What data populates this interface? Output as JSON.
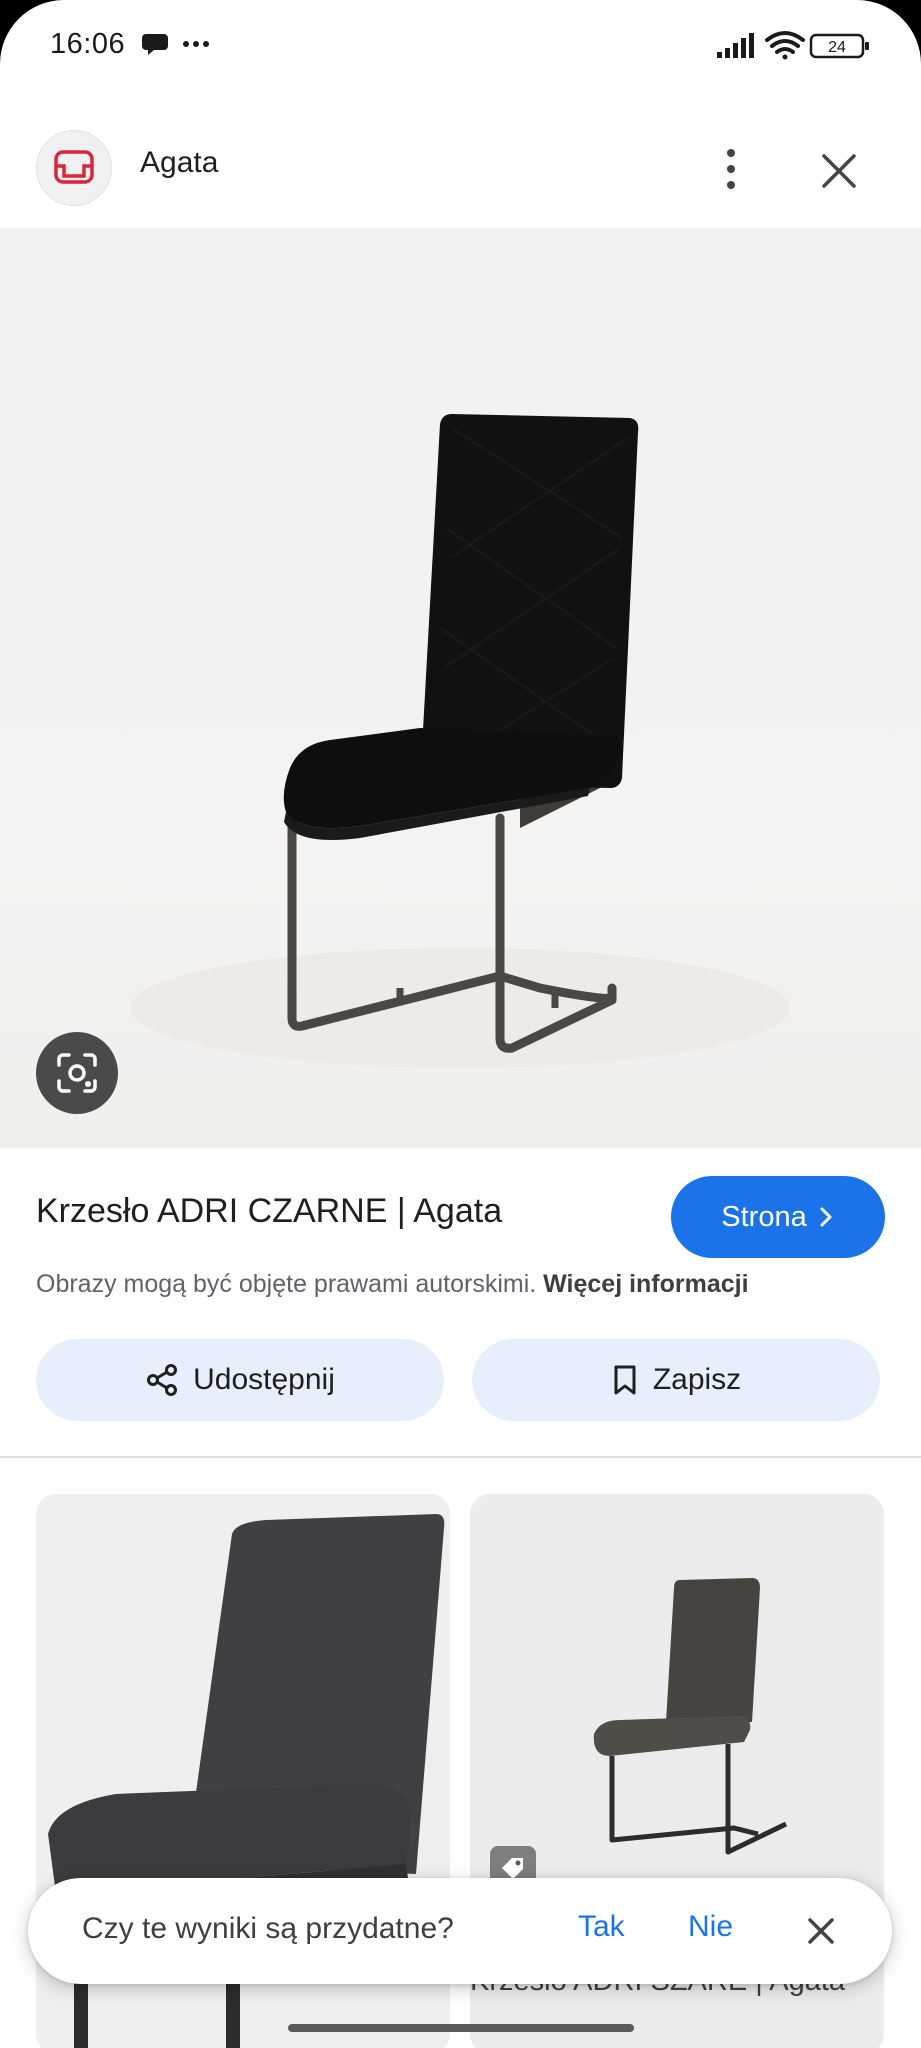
{
  "status_bar": {
    "time": "16:06",
    "battery": "24",
    "icons": [
      "chat-bubble-icon",
      "more-dots-icon",
      "signal-icon",
      "wifi-icon",
      "battery-icon"
    ]
  },
  "header": {
    "site_name": "Agata",
    "favicon": "sofa-logo-icon",
    "accent": "#d7263d"
  },
  "result": {
    "title": "Krzesło ADRI CZARNE | Agata",
    "visit_label": "Strona",
    "copyright_text": "Obrazy mogą być objęte prawami autorskimi.",
    "copyright_link": "Więcej informacji"
  },
  "actions": {
    "share_label": "Udostępnij",
    "save_label": "Zapisz"
  },
  "related": {
    "right_caption": "Krzesło ADRI SZARE | Agata"
  },
  "feedback": {
    "question": "Czy te wyniki są przydatne?",
    "yes": "Tak",
    "no": "Nie"
  },
  "colors": {
    "primary": "#1a73e8",
    "pill_bg": "#e8effc"
  }
}
